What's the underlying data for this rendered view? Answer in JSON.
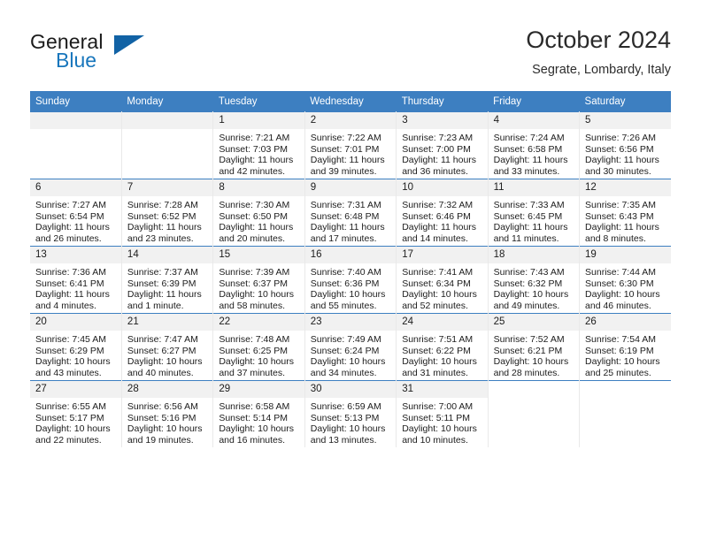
{
  "brand": {
    "name_part1": "General",
    "name_part2": "Blue",
    "triangle_icon": "triangle-icon",
    "accent_color": "#1876bc",
    "triangle_color": "#1162a5"
  },
  "header": {
    "title": "October 2024",
    "subtitle": "Segrate, Lombardy, Italy"
  },
  "calendar": {
    "header_bg": "#3d7fc1",
    "daynum_bg": "#f1f1f1",
    "weekday_headers": [
      "Sunday",
      "Monday",
      "Tuesday",
      "Wednesday",
      "Thursday",
      "Friday",
      "Saturday"
    ],
    "weeks": [
      [
        {
          "day": "",
          "blank": true
        },
        {
          "day": "",
          "blank": true
        },
        {
          "day": "1",
          "sunrise": "Sunrise: 7:21 AM",
          "sunset": "Sunset: 7:03 PM",
          "daylight_1": "Daylight: 11 hours",
          "daylight_2": "and 42 minutes."
        },
        {
          "day": "2",
          "sunrise": "Sunrise: 7:22 AM",
          "sunset": "Sunset: 7:01 PM",
          "daylight_1": "Daylight: 11 hours",
          "daylight_2": "and 39 minutes."
        },
        {
          "day": "3",
          "sunrise": "Sunrise: 7:23 AM",
          "sunset": "Sunset: 7:00 PM",
          "daylight_1": "Daylight: 11 hours",
          "daylight_2": "and 36 minutes."
        },
        {
          "day": "4",
          "sunrise": "Sunrise: 7:24 AM",
          "sunset": "Sunset: 6:58 PM",
          "daylight_1": "Daylight: 11 hours",
          "daylight_2": "and 33 minutes."
        },
        {
          "day": "5",
          "sunrise": "Sunrise: 7:26 AM",
          "sunset": "Sunset: 6:56 PM",
          "daylight_1": "Daylight: 11 hours",
          "daylight_2": "and 30 minutes."
        }
      ],
      [
        {
          "day": "6",
          "sunrise": "Sunrise: 7:27 AM",
          "sunset": "Sunset: 6:54 PM",
          "daylight_1": "Daylight: 11 hours",
          "daylight_2": "and 26 minutes."
        },
        {
          "day": "7",
          "sunrise": "Sunrise: 7:28 AM",
          "sunset": "Sunset: 6:52 PM",
          "daylight_1": "Daylight: 11 hours",
          "daylight_2": "and 23 minutes."
        },
        {
          "day": "8",
          "sunrise": "Sunrise: 7:30 AM",
          "sunset": "Sunset: 6:50 PM",
          "daylight_1": "Daylight: 11 hours",
          "daylight_2": "and 20 minutes."
        },
        {
          "day": "9",
          "sunrise": "Sunrise: 7:31 AM",
          "sunset": "Sunset: 6:48 PM",
          "daylight_1": "Daylight: 11 hours",
          "daylight_2": "and 17 minutes."
        },
        {
          "day": "10",
          "sunrise": "Sunrise: 7:32 AM",
          "sunset": "Sunset: 6:46 PM",
          "daylight_1": "Daylight: 11 hours",
          "daylight_2": "and 14 minutes."
        },
        {
          "day": "11",
          "sunrise": "Sunrise: 7:33 AM",
          "sunset": "Sunset: 6:45 PM",
          "daylight_1": "Daylight: 11 hours",
          "daylight_2": "and 11 minutes."
        },
        {
          "day": "12",
          "sunrise": "Sunrise: 7:35 AM",
          "sunset": "Sunset: 6:43 PM",
          "daylight_1": "Daylight: 11 hours",
          "daylight_2": "and 8 minutes."
        }
      ],
      [
        {
          "day": "13",
          "sunrise": "Sunrise: 7:36 AM",
          "sunset": "Sunset: 6:41 PM",
          "daylight_1": "Daylight: 11 hours",
          "daylight_2": "and 4 minutes."
        },
        {
          "day": "14",
          "sunrise": "Sunrise: 7:37 AM",
          "sunset": "Sunset: 6:39 PM",
          "daylight_1": "Daylight: 11 hours",
          "daylight_2": "and 1 minute."
        },
        {
          "day": "15",
          "sunrise": "Sunrise: 7:39 AM",
          "sunset": "Sunset: 6:37 PM",
          "daylight_1": "Daylight: 10 hours",
          "daylight_2": "and 58 minutes."
        },
        {
          "day": "16",
          "sunrise": "Sunrise: 7:40 AM",
          "sunset": "Sunset: 6:36 PM",
          "daylight_1": "Daylight: 10 hours",
          "daylight_2": "and 55 minutes."
        },
        {
          "day": "17",
          "sunrise": "Sunrise: 7:41 AM",
          "sunset": "Sunset: 6:34 PM",
          "daylight_1": "Daylight: 10 hours",
          "daylight_2": "and 52 minutes."
        },
        {
          "day": "18",
          "sunrise": "Sunrise: 7:43 AM",
          "sunset": "Sunset: 6:32 PM",
          "daylight_1": "Daylight: 10 hours",
          "daylight_2": "and 49 minutes."
        },
        {
          "day": "19",
          "sunrise": "Sunrise: 7:44 AM",
          "sunset": "Sunset: 6:30 PM",
          "daylight_1": "Daylight: 10 hours",
          "daylight_2": "and 46 minutes."
        }
      ],
      [
        {
          "day": "20",
          "sunrise": "Sunrise: 7:45 AM",
          "sunset": "Sunset: 6:29 PM",
          "daylight_1": "Daylight: 10 hours",
          "daylight_2": "and 43 minutes."
        },
        {
          "day": "21",
          "sunrise": "Sunrise: 7:47 AM",
          "sunset": "Sunset: 6:27 PM",
          "daylight_1": "Daylight: 10 hours",
          "daylight_2": "and 40 minutes."
        },
        {
          "day": "22",
          "sunrise": "Sunrise: 7:48 AM",
          "sunset": "Sunset: 6:25 PM",
          "daylight_1": "Daylight: 10 hours",
          "daylight_2": "and 37 minutes."
        },
        {
          "day": "23",
          "sunrise": "Sunrise: 7:49 AM",
          "sunset": "Sunset: 6:24 PM",
          "daylight_1": "Daylight: 10 hours",
          "daylight_2": "and 34 minutes."
        },
        {
          "day": "24",
          "sunrise": "Sunrise: 7:51 AM",
          "sunset": "Sunset: 6:22 PM",
          "daylight_1": "Daylight: 10 hours",
          "daylight_2": "and 31 minutes."
        },
        {
          "day": "25",
          "sunrise": "Sunrise: 7:52 AM",
          "sunset": "Sunset: 6:21 PM",
          "daylight_1": "Daylight: 10 hours",
          "daylight_2": "and 28 minutes."
        },
        {
          "day": "26",
          "sunrise": "Sunrise: 7:54 AM",
          "sunset": "Sunset: 6:19 PM",
          "daylight_1": "Daylight: 10 hours",
          "daylight_2": "and 25 minutes."
        }
      ],
      [
        {
          "day": "27",
          "sunrise": "Sunrise: 6:55 AM",
          "sunset": "Sunset: 5:17 PM",
          "daylight_1": "Daylight: 10 hours",
          "daylight_2": "and 22 minutes."
        },
        {
          "day": "28",
          "sunrise": "Sunrise: 6:56 AM",
          "sunset": "Sunset: 5:16 PM",
          "daylight_1": "Daylight: 10 hours",
          "daylight_2": "and 19 minutes."
        },
        {
          "day": "29",
          "sunrise": "Sunrise: 6:58 AM",
          "sunset": "Sunset: 5:14 PM",
          "daylight_1": "Daylight: 10 hours",
          "daylight_2": "and 16 minutes."
        },
        {
          "day": "30",
          "sunrise": "Sunrise: 6:59 AM",
          "sunset": "Sunset: 5:13 PM",
          "daylight_1": "Daylight: 10 hours",
          "daylight_2": "and 13 minutes."
        },
        {
          "day": "31",
          "sunrise": "Sunrise: 7:00 AM",
          "sunset": "Sunset: 5:11 PM",
          "daylight_1": "Daylight: 10 hours",
          "daylight_2": "and 10 minutes."
        },
        {
          "day": "",
          "void": true
        },
        {
          "day": "",
          "void": true
        }
      ]
    ]
  }
}
